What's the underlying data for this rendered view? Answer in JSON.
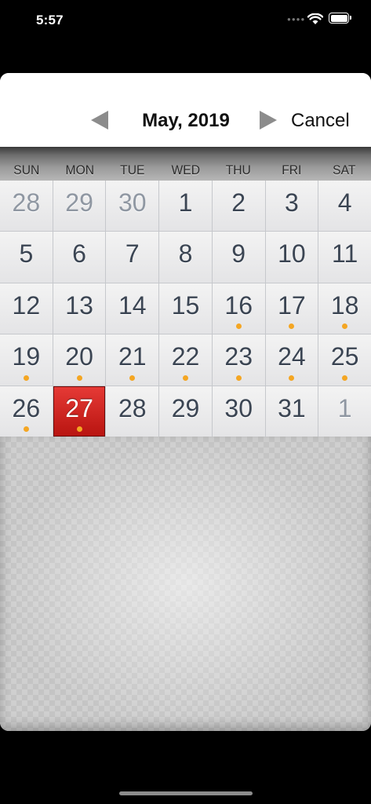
{
  "status": {
    "time": "5:57"
  },
  "header": {
    "month_label": "May, 2019",
    "cancel_label": "Cancel"
  },
  "weekdays": [
    "SUN",
    "MON",
    "TUE",
    "WED",
    "THU",
    "FRI",
    "SAT"
  ],
  "days": [
    {
      "label": "28",
      "other": true,
      "event": false
    },
    {
      "label": "29",
      "other": true,
      "event": false
    },
    {
      "label": "30",
      "other": true,
      "event": false
    },
    {
      "label": "1",
      "other": false,
      "event": false
    },
    {
      "label": "2",
      "other": false,
      "event": false
    },
    {
      "label": "3",
      "other": false,
      "event": false
    },
    {
      "label": "4",
      "other": false,
      "event": false
    },
    {
      "label": "5",
      "other": false,
      "event": false
    },
    {
      "label": "6",
      "other": false,
      "event": false
    },
    {
      "label": "7",
      "other": false,
      "event": false
    },
    {
      "label": "8",
      "other": false,
      "event": false
    },
    {
      "label": "9",
      "other": false,
      "event": false
    },
    {
      "label": "10",
      "other": false,
      "event": false
    },
    {
      "label": "11",
      "other": false,
      "event": false
    },
    {
      "label": "12",
      "other": false,
      "event": false
    },
    {
      "label": "13",
      "other": false,
      "event": false
    },
    {
      "label": "14",
      "other": false,
      "event": false
    },
    {
      "label": "15",
      "other": false,
      "event": false
    },
    {
      "label": "16",
      "other": false,
      "event": true
    },
    {
      "label": "17",
      "other": false,
      "event": true
    },
    {
      "label": "18",
      "other": false,
      "event": true
    },
    {
      "label": "19",
      "other": false,
      "event": true
    },
    {
      "label": "20",
      "other": false,
      "event": true
    },
    {
      "label": "21",
      "other": false,
      "event": true
    },
    {
      "label": "22",
      "other": false,
      "event": true
    },
    {
      "label": "23",
      "other": false,
      "event": true
    },
    {
      "label": "24",
      "other": false,
      "event": true
    },
    {
      "label": "25",
      "other": false,
      "event": true
    },
    {
      "label": "26",
      "other": false,
      "event": true
    },
    {
      "label": "27",
      "other": false,
      "event": true,
      "selected": true
    },
    {
      "label": "28",
      "other": false,
      "event": false
    },
    {
      "label": "29",
      "other": false,
      "event": false
    },
    {
      "label": "30",
      "other": false,
      "event": false
    },
    {
      "label": "31",
      "other": false,
      "event": false
    },
    {
      "label": "1",
      "other": true,
      "event": false
    }
  ],
  "colors": {
    "selected": "#d42420",
    "event_dot": "#f4a623",
    "date_text": "#3b4553"
  }
}
